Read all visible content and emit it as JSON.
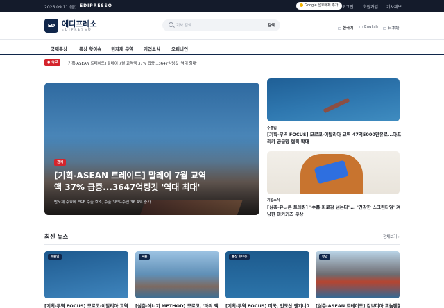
{
  "topbar": {
    "date": "2026.09.11 (금)",
    "brand": "EDIPRESSO",
    "google_button": "Google 선호매체 추가",
    "links": [
      "로그인",
      "회원가입",
      "기사제보"
    ]
  },
  "header": {
    "logo_mark": "ED",
    "logo_name": "에디프레소",
    "logo_sub": "EDIPRESSO",
    "search_placeholder": "기사 검색",
    "search_button": "검색",
    "languages": [
      "한국어",
      "English",
      "日本語"
    ]
  },
  "nav": {
    "items": [
      "국제통상",
      "통상 핫이슈",
      "원자재 무역",
      "기업소식",
      "오피니언"
    ]
  },
  "breaking": {
    "badge": "속보",
    "text": "[기획-ASEAN 트레이드] 말레이 7월 교역액 37% 급증...3647억링깃 '역대 최대'"
  },
  "feature": {
    "tag": "관세",
    "title": "[기획-ASEAN 트레이드] 말레이 7월 교역액 37% 급증...3647억링깃 '역대 최대'",
    "subtitle": "반도체 수요에 E&E 수출 호조, 수출 38%·수입 36.4% 증가"
  },
  "side_stories": [
    {
      "category": "수출입",
      "title": "[기획-무역 FOCUS] 모로코-이탈리아 교역 47억5000만유로...아프리카 공급망 협력 확대"
    },
    {
      "category": "기업소식",
      "title": "[심층-유니콘 트레킹] \"숏폼 피로감 넘는다\"... '건강한 스크린타임' 겨냥한 마카키즈 부상"
    }
  ],
  "latest": {
    "title": "최신 뉴스",
    "more": "전체보기 ›",
    "cards": [
      {
        "tag": "수출입",
        "title": "[기획-무역 FOCUS] 모로코-이탈리아 교역"
      },
      {
        "tag": "곡물",
        "title": "[심층-에너지 METHOD] 모로코, '파워 엑스"
      },
      {
        "tag": "통상 핫이슈",
        "title": "[기획-무역 FOCUS] 미국, 인도산 엔지니어"
      },
      {
        "tag": "항만",
        "title": "[심층-ASEAN 트레이드] 캄보디아 프놈펜항"
      }
    ]
  },
  "colors": {
    "brand_navy": "#10264a",
    "breaking_red": "#d4242c",
    "topbar": "#141b2b"
  }
}
